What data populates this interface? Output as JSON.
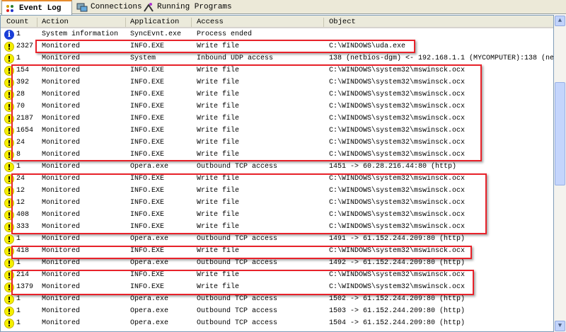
{
  "tabs": [
    {
      "label": "Event Log",
      "icon": "event-log-icon"
    },
    {
      "label": "Connections",
      "icon": "connections-icon"
    },
    {
      "label": "Running Programs",
      "icon": "running-programs-icon"
    }
  ],
  "columns": [
    "Count",
    "Action",
    "Application",
    "Access",
    "Object"
  ],
  "colors": {
    "highlight": "#e8222a",
    "warning": "#f5f000",
    "info": "#1a3fd8"
  },
  "rows": [
    {
      "icon": "info",
      "count": "1",
      "action": "System information",
      "app": "SyncEvnt.exe",
      "access": "Process ended",
      "object": ""
    },
    {
      "icon": "warn",
      "count": "2327",
      "action": "Monitored",
      "app": "INFO.EXE",
      "access": "Write file",
      "object": "C:\\WINDOWS\\uda.exe"
    },
    {
      "icon": "warn",
      "count": "1",
      "action": "Monitored",
      "app": "System",
      "access": "Inbound UDP access",
      "object": "138 (netbios-dgm) <- 192.168.1.1 (MYCOMPUTER):138 (ne"
    },
    {
      "icon": "warn",
      "count": "154",
      "action": "Monitored",
      "app": "INFO.EXE",
      "access": "Write file",
      "object": "C:\\WINDOWS\\system32\\mswinsck.ocx"
    },
    {
      "icon": "warn",
      "count": "392",
      "action": "Monitored",
      "app": "INFO.EXE",
      "access": "Write file",
      "object": "C:\\WINDOWS\\system32\\mswinsck.ocx"
    },
    {
      "icon": "warn",
      "count": "28",
      "action": "Monitored",
      "app": "INFO.EXE",
      "access": "Write file",
      "object": "C:\\WINDOWS\\system32\\mswinsck.ocx"
    },
    {
      "icon": "warn",
      "count": "70",
      "action": "Monitored",
      "app": "INFO.EXE",
      "access": "Write file",
      "object": "C:\\WINDOWS\\system32\\mswinsck.ocx"
    },
    {
      "icon": "warn",
      "count": "2187",
      "action": "Monitored",
      "app": "INFO.EXE",
      "access": "Write file",
      "object": "C:\\WINDOWS\\system32\\mswinsck.ocx"
    },
    {
      "icon": "warn",
      "count": "1654",
      "action": "Monitored",
      "app": "INFO.EXE",
      "access": "Write file",
      "object": "C:\\WINDOWS\\system32\\mswinsck.ocx"
    },
    {
      "icon": "warn",
      "count": "24",
      "action": "Monitored",
      "app": "INFO.EXE",
      "access": "Write file",
      "object": "C:\\WINDOWS\\system32\\mswinsck.ocx"
    },
    {
      "icon": "warn",
      "count": "8",
      "action": "Monitored",
      "app": "INFO.EXE",
      "access": "Write file",
      "object": "C:\\WINDOWS\\system32\\mswinsck.ocx"
    },
    {
      "icon": "warn",
      "count": "1",
      "action": "Monitored",
      "app": "Opera.exe",
      "access": "Outbound TCP access",
      "object": "1451 -> 60.28.216.44:80 (http)"
    },
    {
      "icon": "warn",
      "count": "24",
      "action": "Monitored",
      "app": "INFO.EXE",
      "access": "Write file",
      "object": "C:\\WINDOWS\\system32\\mswinsck.ocx"
    },
    {
      "icon": "warn",
      "count": "12",
      "action": "Monitored",
      "app": "INFO.EXE",
      "access": "Write file",
      "object": "C:\\WINDOWS\\system32\\mswinsck.ocx"
    },
    {
      "icon": "warn",
      "count": "12",
      "action": "Monitored",
      "app": "INFO.EXE",
      "access": "Write file",
      "object": "C:\\WINDOWS\\system32\\mswinsck.ocx"
    },
    {
      "icon": "warn",
      "count": "408",
      "action": "Monitored",
      "app": "INFO.EXE",
      "access": "Write file",
      "object": "C:\\WINDOWS\\system32\\mswinsck.ocx"
    },
    {
      "icon": "warn",
      "count": "333",
      "action": "Monitored",
      "app": "INFO.EXE",
      "access": "Write file",
      "object": "C:\\WINDOWS\\system32\\mswinsck.ocx"
    },
    {
      "icon": "warn",
      "count": "1",
      "action": "Monitored",
      "app": "Opera.exe",
      "access": "Outbound TCP access",
      "object": "1491 -> 61.152.244.209:80 (http)"
    },
    {
      "icon": "warn",
      "count": "418",
      "action": "Monitored",
      "app": "INFO.EXE",
      "access": "Write file",
      "object": "C:\\WINDOWS\\system32\\mswinsck.ocx"
    },
    {
      "icon": "warn",
      "count": "1",
      "action": "Monitored",
      "app": "Opera.exe",
      "access": "Outbound TCP access",
      "object": "1492 -> 61.152.244.209:80 (http)"
    },
    {
      "icon": "warn",
      "count": "214",
      "action": "Monitored",
      "app": "INFO.EXE",
      "access": "Write file",
      "object": "C:\\WINDOWS\\system32\\mswinsck.ocx"
    },
    {
      "icon": "warn",
      "count": "1379",
      "action": "Monitored",
      "app": "INFO.EXE",
      "access": "Write file",
      "object": "C:\\WINDOWS\\system32\\mswinsck.ocx"
    },
    {
      "icon": "warn",
      "count": "1",
      "action": "Monitored",
      "app": "Opera.exe",
      "access": "Outbound TCP access",
      "object": "1502 -> 61.152.244.209:80 (http)"
    },
    {
      "icon": "warn",
      "count": "1",
      "action": "Monitored",
      "app": "Opera.exe",
      "access": "Outbound TCP access",
      "object": "1503 -> 61.152.244.209:80 (http)"
    },
    {
      "icon": "warn",
      "count": "1",
      "action": "Monitored",
      "app": "Opera.exe",
      "access": "Outbound TCP access",
      "object": "1504 -> 61.152.244.209:80 (http)"
    }
  ]
}
